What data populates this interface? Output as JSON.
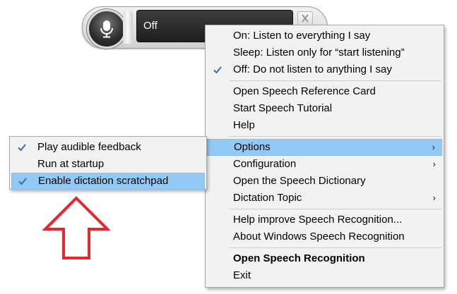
{
  "speech_bar": {
    "status_text": "Off",
    "mic_icon": "microphone-icon",
    "close_icon": "close-icon"
  },
  "main_menu": {
    "items": [
      {
        "label": "On: Listen to everything I say",
        "checked": false
      },
      {
        "label": "Sleep: Listen only for “start listening”",
        "checked": false
      },
      {
        "label": "Off: Do not listen to anything I say",
        "checked": true
      },
      {
        "label": "Open Speech Reference Card"
      },
      {
        "label": "Start Speech Tutorial"
      },
      {
        "label": "Help"
      },
      {
        "label": "Options",
        "submenu": true,
        "highlighted": true
      },
      {
        "label": "Configuration",
        "submenu": true
      },
      {
        "label": "Open the Speech Dictionary"
      },
      {
        "label": "Dictation Topic",
        "submenu": true
      },
      {
        "label": "Help improve Speech Recognition..."
      },
      {
        "label": "About Windows Speech Recognition"
      },
      {
        "label": "Open Speech Recognition",
        "bold": true
      },
      {
        "label": "Exit"
      }
    ],
    "submenu_glyph": "›"
  },
  "options_submenu": {
    "items": [
      {
        "label": "Play audible feedback",
        "checked": true
      },
      {
        "label": "Run at startup",
        "checked": false
      },
      {
        "label": "Enable dictation scratchpad",
        "checked": true,
        "highlighted": true
      }
    ]
  },
  "annotation": {
    "arrow_color": "#e8262b",
    "icon": "red-up-arrow-icon"
  },
  "colors": {
    "highlight": "#91c9f7",
    "check": "#3a6ea5",
    "menu_bg": "#f2f2f2"
  }
}
